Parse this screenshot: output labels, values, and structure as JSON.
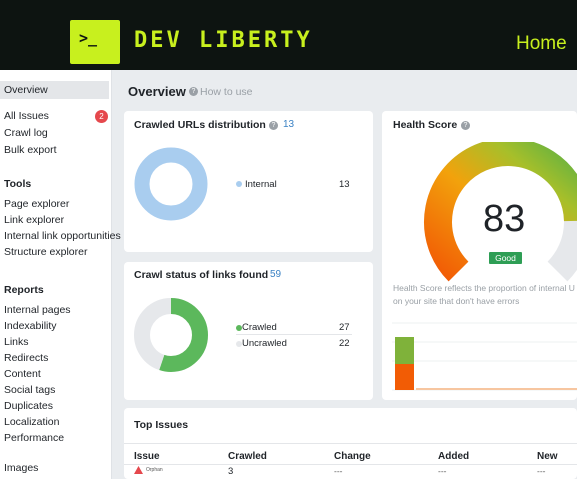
{
  "header": {
    "logo_glyph": ">_",
    "brand": "DEV LIBERTY",
    "home_link": "Home",
    "accent_color": "#c8f01e"
  },
  "sidebar": {
    "overview": "Overview",
    "all_issues": "All Issues",
    "all_issues_badge": "2",
    "crawl_log": "Crawl log",
    "bulk_export": "Bulk export",
    "tools_heading": "Tools",
    "tools": [
      "Page explorer",
      "Link explorer",
      "Internal link opportunities",
      "Structure explorer"
    ],
    "reports_heading": "Reports",
    "reports": [
      "Internal pages",
      "Indexability",
      "Links",
      "Redirects",
      "Content",
      "Social tags",
      "Duplicates",
      "Localization",
      "Performance"
    ],
    "images": "Images"
  },
  "main": {
    "title": "Overview",
    "how_to_use": "How to use"
  },
  "crawled_urls": {
    "title": "Crawled URLs distribution",
    "count": "13",
    "legend": [
      {
        "label": "Internal",
        "value": "13",
        "color": "#a9cdef"
      }
    ]
  },
  "crawl_status": {
    "title": "Crawl status of links found",
    "count": "59",
    "legend": [
      {
        "label": "Crawled",
        "value": "27",
        "color": "#5cb85c"
      },
      {
        "label": "Uncrawled",
        "value": "22",
        "color": "#e6e8eb"
      }
    ]
  },
  "health_score": {
    "title": "Health Score",
    "score": "83",
    "score_fraction": 0.83,
    "status": "Good",
    "description_line1": "Health Score reflects the proportion of internal U",
    "description_line2": "on your site that don't have errors"
  },
  "top_issues": {
    "title": "Top Issues",
    "columns": [
      "Issue",
      "Crawled",
      "Change",
      "Added",
      "New"
    ],
    "rows": [
      {
        "issue": "Orphan",
        "crawled": "3",
        "change": "---",
        "added": "---",
        "new": "---"
      }
    ]
  }
}
